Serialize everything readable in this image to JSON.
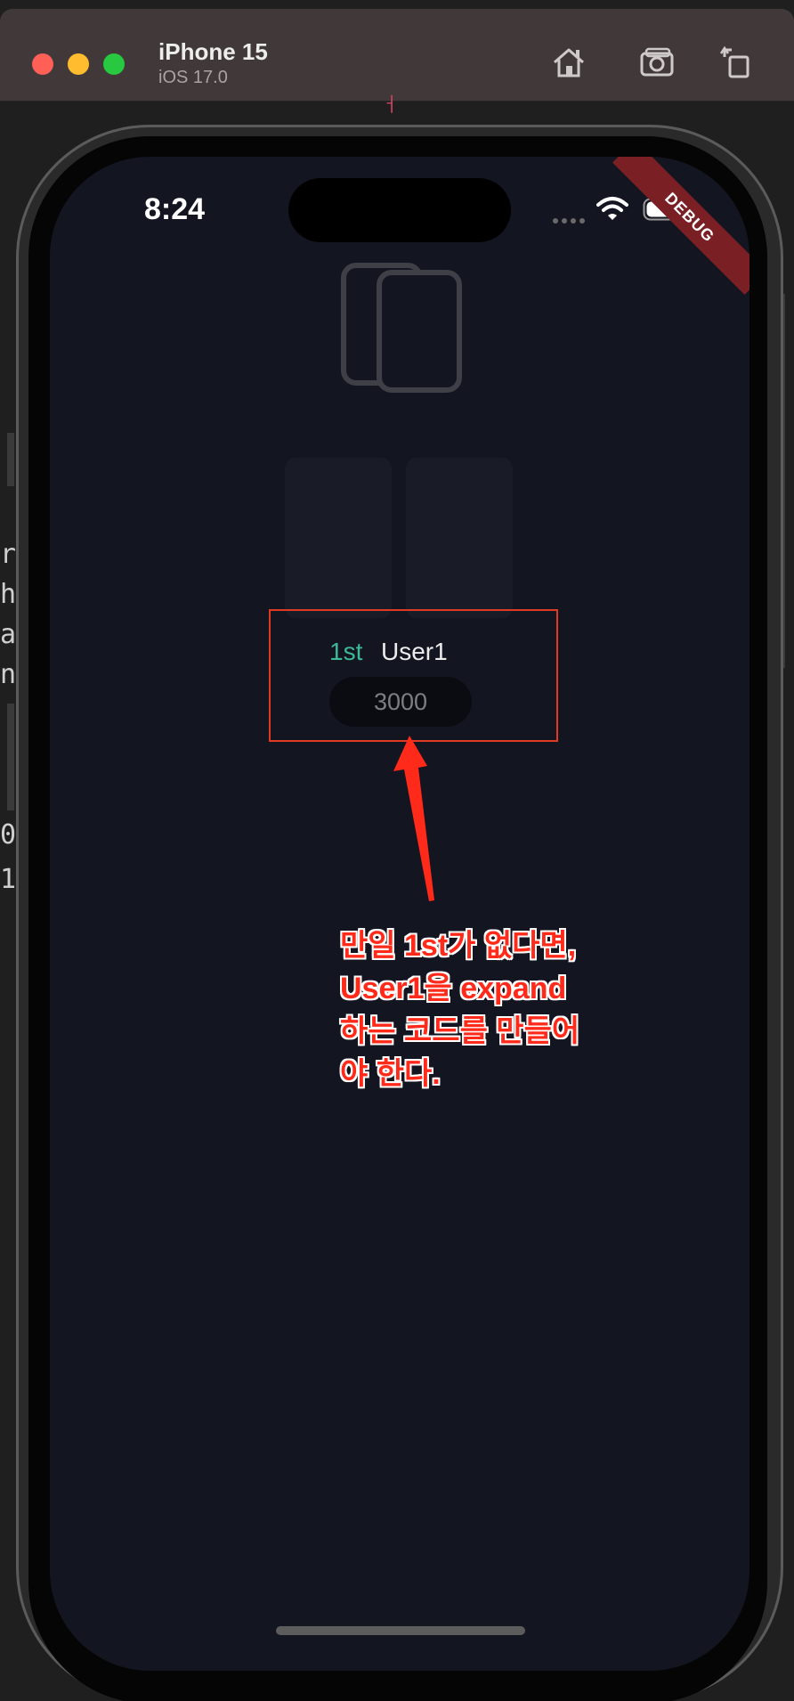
{
  "window": {
    "device_name": "iPhone 15",
    "os_version": "iOS 17.0",
    "icons": [
      "home-icon",
      "screenshot-icon",
      "rotate-icon"
    ]
  },
  "status_bar": {
    "time": "8:24",
    "debug_banner": "DEBUG"
  },
  "app": {
    "rank": "1st",
    "user": "User1",
    "score": "3000"
  },
  "annotation": {
    "text": "만일 1st가 없다면,\nUser1을 expand\n하는 코드를 만들어\n야 한다.",
    "color": "#ff2a1a"
  },
  "colors": {
    "screen_bg": "#131520",
    "rank_accent": "#3db998",
    "highlight_border": "#e13a22"
  }
}
